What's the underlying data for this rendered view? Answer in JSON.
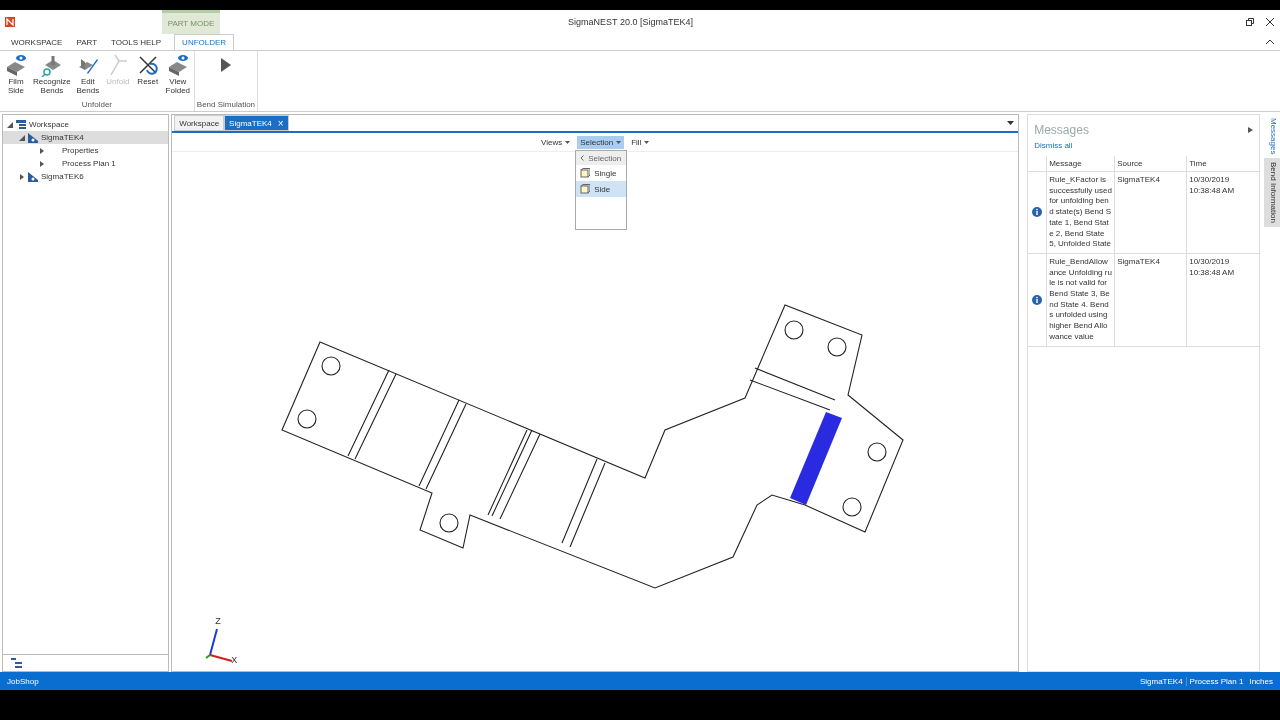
{
  "window": {
    "title": "SigmaNEST 20.0 [SigmaTEK4]",
    "mode_label": "PART MODE"
  },
  "ribbon_tabs": [
    {
      "label": "WORKSPACE",
      "selected": false
    },
    {
      "label": "PART",
      "selected": false
    },
    {
      "label": "TOOLS HELP",
      "selected": false
    },
    {
      "label": "UNFOLDER",
      "selected": true
    }
  ],
  "ribbon_groups": [
    {
      "label": "Unfolder",
      "buttons": [
        {
          "label": "Film Side",
          "kind": "film",
          "disabled": false
        },
        {
          "label": "Recognize Bends",
          "kind": "recognize",
          "disabled": false
        },
        {
          "label": "Edit Bends",
          "kind": "edit",
          "disabled": false
        },
        {
          "label": "Unfold",
          "kind": "unfold",
          "disabled": true
        },
        {
          "label": "Reset",
          "kind": "reset",
          "disabled": false
        },
        {
          "label": "View Folded",
          "kind": "view",
          "disabled": false
        }
      ]
    },
    {
      "label": "Bend Simulation",
      "buttons": [
        {
          "kind": "play"
        }
      ]
    }
  ],
  "tree": [
    {
      "label": "Workspace",
      "kind": "workspace",
      "expanded": true,
      "selected": false,
      "children": [
        {
          "label": "SigmaTEK4",
          "kind": "part",
          "expanded": true,
          "selected": true,
          "children": [
            {
              "label": "Properties",
              "kind": "node",
              "expanded": false,
              "selected": false
            },
            {
              "label": "Process Plan 1",
              "kind": "node",
              "expanded": false,
              "selected": false
            }
          ]
        },
        {
          "label": "SigmaTEK6",
          "kind": "part",
          "expanded": false,
          "selected": false
        }
      ]
    }
  ],
  "doc_tabs": [
    {
      "label": "Workspace",
      "selected": false
    },
    {
      "label": "SigmaTEK4",
      "selected": true,
      "closable": "×"
    }
  ],
  "view_menus": [
    {
      "label": "Views",
      "selected": false
    },
    {
      "label": "Selection",
      "selected": true
    },
    {
      "label": "Fill",
      "selected": false
    }
  ],
  "selection_menu": {
    "header": "Selection",
    "items": [
      {
        "label": "Single",
        "selected": false
      },
      {
        "label": "Side",
        "selected": true
      }
    ]
  },
  "messages": {
    "title": "Messages",
    "dismiss": "Dismiss all",
    "columns": [
      "Message",
      "Source",
      "Time"
    ],
    "rows": [
      {
        "message": "Rule_KFactor is successfully used for unfolding bend state(s) Bend State 1, Bend State 2, Bend State 5, Unfolded State",
        "source": "SigmaTEK4",
        "time": "10/30/2019 10:38:48 AM"
      },
      {
        "message": "Rule_BendAllowance Unfolding rule is not valid for Bend State 3, Bend State 4. Bends unfolded using higher Bend Allowance value",
        "source": "SigmaTEK4",
        "time": "10/30/2019 10:38:48 AM"
      }
    ]
  },
  "side_tabs": [
    {
      "label": "Messages",
      "selected": true
    },
    {
      "label": "Bend Information",
      "selected": false
    }
  ],
  "axes": {
    "z": "Z",
    "x": "X"
  },
  "status_bar": {
    "left": "JobShop",
    "right": [
      "SigmaTEK4",
      "Process Plan 1",
      "Inches"
    ]
  }
}
